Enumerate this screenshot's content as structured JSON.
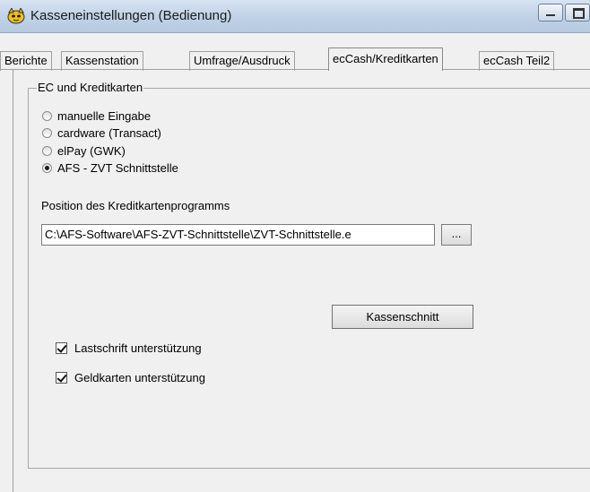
{
  "window": {
    "title": "Kasseneinstellungen (Bedienung)",
    "icon": "cat-app-icon"
  },
  "tabs": [
    {
      "label": "Berichte",
      "active": false
    },
    {
      "label": "Kassenstation",
      "active": false
    },
    {
      "label": "Umfrage/Ausdruck",
      "active": false
    },
    {
      "label": "ecCash/Kreditkarten",
      "active": true
    },
    {
      "label": "ecCash Teil2",
      "active": false
    }
  ],
  "group": {
    "title": "EC und Kreditkarten",
    "options": [
      {
        "label": "manuelle Eingabe",
        "checked": false
      },
      {
        "label": "cardware (Transact)",
        "checked": false
      },
      {
        "label": "elPay (GWK)",
        "checked": false
      },
      {
        "label": "AFS - ZVT Schnittstelle",
        "checked": true
      }
    ],
    "path_label": "Position des Kreditkartenprogramms",
    "path_value": "C:\\AFS-Software\\AFS-ZVT-Schnittstelle\\ZVT-Schnittstelle.e",
    "browse_label": "...",
    "kassenschnitt_label": "Kassenschnitt",
    "checkboxes": [
      {
        "label": "Lastschrift unterstützung",
        "checked": true
      },
      {
        "label": "Geldkarten unterstützung",
        "checked": true
      }
    ]
  }
}
